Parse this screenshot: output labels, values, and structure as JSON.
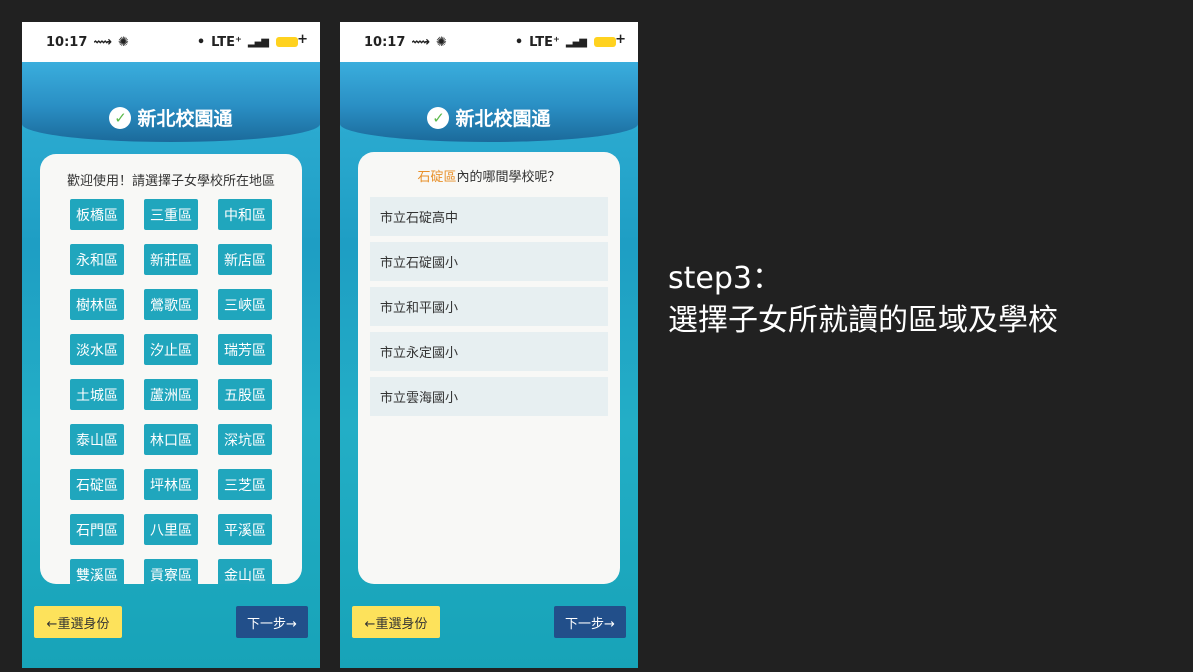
{
  "status": {
    "time": "10:17",
    "network": "LTE⁺"
  },
  "app": {
    "title": "新北校園通"
  },
  "left": {
    "prompt": "歡迎使用！請選擇子女學校所在地區",
    "districts": [
      "板橋區",
      "三重區",
      "中和區",
      "永和區",
      "新莊區",
      "新店區",
      "樹林區",
      "鶯歌區",
      "三峽區",
      "淡水區",
      "汐止區",
      "瑞芳區",
      "土城區",
      "蘆洲區",
      "五股區",
      "泰山區",
      "林口區",
      "深坑區",
      "石碇區",
      "坪林區",
      "三芝區",
      "石門區",
      "八里區",
      "平溪區",
      "雙溪區",
      "貢寮區",
      "金山區"
    ],
    "back_label": "←重選身份",
    "next_label": "下一步→"
  },
  "right": {
    "prompt_district": "石碇區",
    "prompt_suffix": "內的哪間學校呢？",
    "schools": [
      "市立石碇高中",
      "市立石碇國小",
      "市立和平國小",
      "市立永定國小",
      "市立雲海國小"
    ],
    "back_label": "←重選身份",
    "next_label": "下一步→"
  },
  "caption": {
    "line1": "step3：",
    "line2": "選擇子女所就讀的區域及學校"
  },
  "colors": {
    "district_button": "#20a6bd",
    "back_button": "#fde25b",
    "next_button": "#224f8a",
    "highlight": "#e8902a"
  }
}
